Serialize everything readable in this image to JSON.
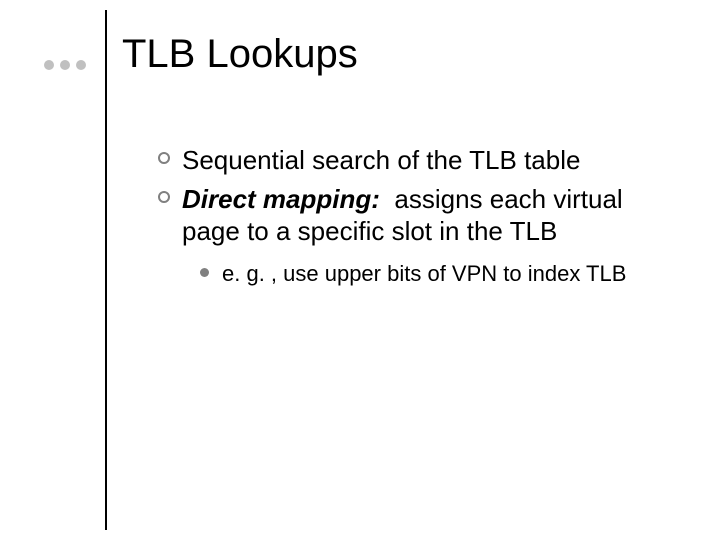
{
  "title": "TLB Lookups",
  "bullets": {
    "b1": "Sequential search of the TLB table",
    "b2_strong": "Direct mapping:",
    "b2_spaces": "  ",
    "b2_rest": "assigns each virtual page to a specific slot in the TLB",
    "sub1": "e. g. , use upper bits of VPN to index TLB"
  }
}
